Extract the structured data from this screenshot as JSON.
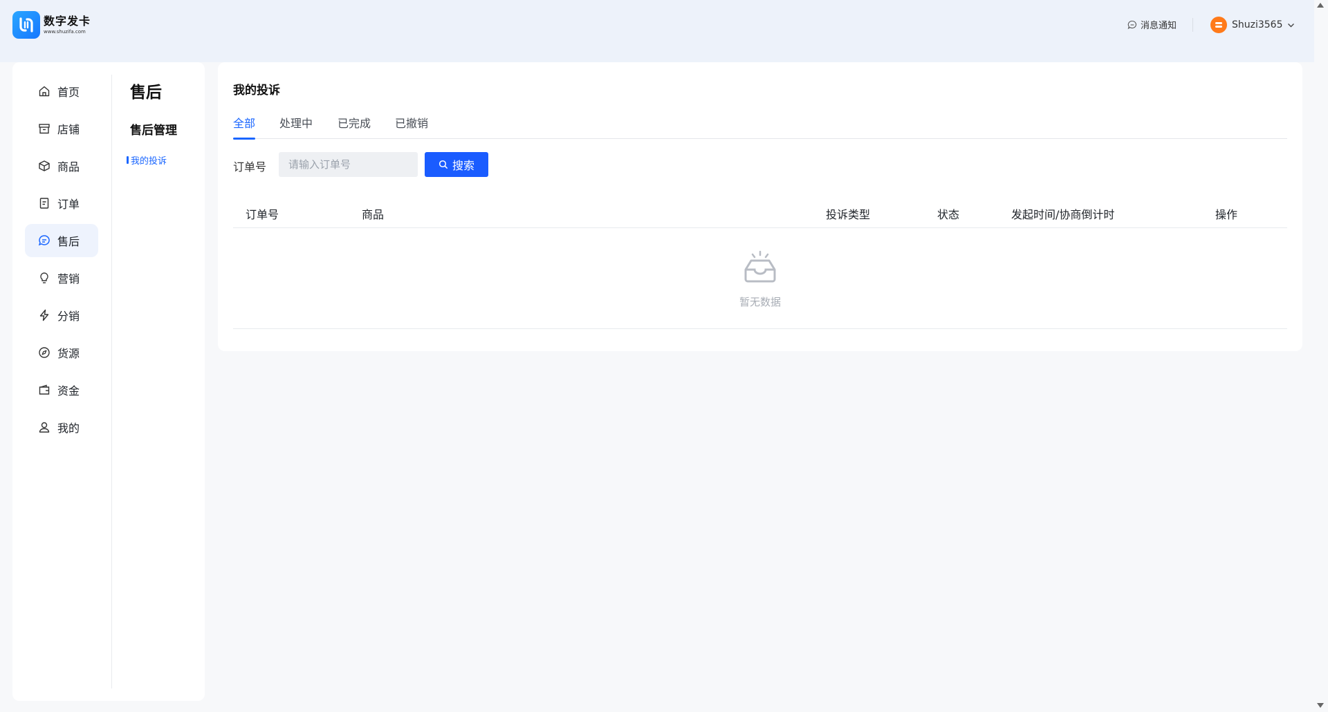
{
  "header": {
    "logo_name": "数字发卡",
    "logo_url": "www.shuzifa.com",
    "notify_label": "消息通知",
    "username": "Shuzi3565"
  },
  "nav": {
    "items": [
      {
        "label": "首页",
        "icon": "home-icon"
      },
      {
        "label": "店铺",
        "icon": "store-icon"
      },
      {
        "label": "商品",
        "icon": "box-icon"
      },
      {
        "label": "订单",
        "icon": "document-icon"
      },
      {
        "label": "售后",
        "icon": "chat-icon",
        "active": true
      },
      {
        "label": "营销",
        "icon": "lightbulb-icon"
      },
      {
        "label": "分销",
        "icon": "lightning-icon"
      },
      {
        "label": "货源",
        "icon": "compass-icon"
      },
      {
        "label": "资金",
        "icon": "wallet-icon"
      },
      {
        "label": "我的",
        "icon": "user-icon"
      }
    ]
  },
  "subnav": {
    "title": "售后",
    "group": "售后管理",
    "item": "我的投诉"
  },
  "main": {
    "title": "我的投诉",
    "tabs": [
      {
        "label": "全部",
        "active": true
      },
      {
        "label": "处理中"
      },
      {
        "label": "已完成"
      },
      {
        "label": "已撤销"
      }
    ],
    "search": {
      "label": "订单号",
      "placeholder": "请输入订单号",
      "value": "",
      "button": "搜索"
    },
    "table": {
      "columns": [
        "订单号",
        "商品",
        "投诉类型",
        "状态",
        "发起时间/协商倒计时",
        "操作"
      ],
      "rows": [],
      "empty_text": "暂无数据"
    }
  },
  "colors": {
    "accent": "#1a5cff",
    "active_text": "#1a66ff",
    "page_bg": "#f7f8fa",
    "header_bg": "#edf2fa",
    "avatar": "#ff7a1a"
  }
}
